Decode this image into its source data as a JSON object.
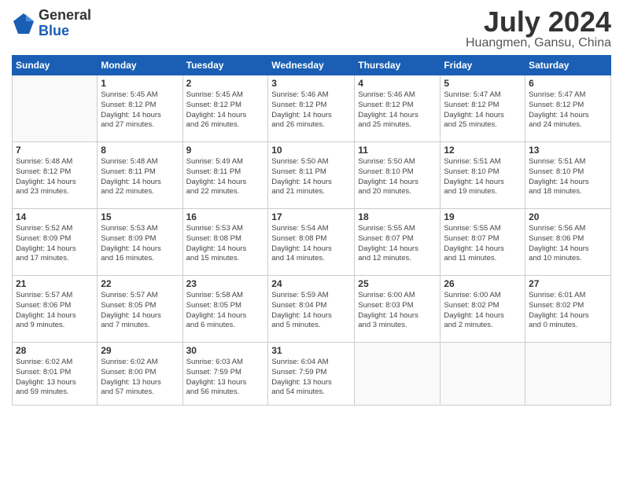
{
  "header": {
    "logo_general": "General",
    "logo_blue": "Blue",
    "title": "July 2024",
    "location": "Huangmen, Gansu, China"
  },
  "weekdays": [
    "Sunday",
    "Monday",
    "Tuesday",
    "Wednesday",
    "Thursday",
    "Friday",
    "Saturday"
  ],
  "weeks": [
    [
      {
        "day": "",
        "info": ""
      },
      {
        "day": "1",
        "info": "Sunrise: 5:45 AM\nSunset: 8:12 PM\nDaylight: 14 hours\nand 27 minutes."
      },
      {
        "day": "2",
        "info": "Sunrise: 5:45 AM\nSunset: 8:12 PM\nDaylight: 14 hours\nand 26 minutes."
      },
      {
        "day": "3",
        "info": "Sunrise: 5:46 AM\nSunset: 8:12 PM\nDaylight: 14 hours\nand 26 minutes."
      },
      {
        "day": "4",
        "info": "Sunrise: 5:46 AM\nSunset: 8:12 PM\nDaylight: 14 hours\nand 25 minutes."
      },
      {
        "day": "5",
        "info": "Sunrise: 5:47 AM\nSunset: 8:12 PM\nDaylight: 14 hours\nand 25 minutes."
      },
      {
        "day": "6",
        "info": "Sunrise: 5:47 AM\nSunset: 8:12 PM\nDaylight: 14 hours\nand 24 minutes."
      }
    ],
    [
      {
        "day": "7",
        "info": "Sunrise: 5:48 AM\nSunset: 8:12 PM\nDaylight: 14 hours\nand 23 minutes."
      },
      {
        "day": "8",
        "info": "Sunrise: 5:48 AM\nSunset: 8:11 PM\nDaylight: 14 hours\nand 22 minutes."
      },
      {
        "day": "9",
        "info": "Sunrise: 5:49 AM\nSunset: 8:11 PM\nDaylight: 14 hours\nand 22 minutes."
      },
      {
        "day": "10",
        "info": "Sunrise: 5:50 AM\nSunset: 8:11 PM\nDaylight: 14 hours\nand 21 minutes."
      },
      {
        "day": "11",
        "info": "Sunrise: 5:50 AM\nSunset: 8:10 PM\nDaylight: 14 hours\nand 20 minutes."
      },
      {
        "day": "12",
        "info": "Sunrise: 5:51 AM\nSunset: 8:10 PM\nDaylight: 14 hours\nand 19 minutes."
      },
      {
        "day": "13",
        "info": "Sunrise: 5:51 AM\nSunset: 8:10 PM\nDaylight: 14 hours\nand 18 minutes."
      }
    ],
    [
      {
        "day": "14",
        "info": "Sunrise: 5:52 AM\nSunset: 8:09 PM\nDaylight: 14 hours\nand 17 minutes."
      },
      {
        "day": "15",
        "info": "Sunrise: 5:53 AM\nSunset: 8:09 PM\nDaylight: 14 hours\nand 16 minutes."
      },
      {
        "day": "16",
        "info": "Sunrise: 5:53 AM\nSunset: 8:08 PM\nDaylight: 14 hours\nand 15 minutes."
      },
      {
        "day": "17",
        "info": "Sunrise: 5:54 AM\nSunset: 8:08 PM\nDaylight: 14 hours\nand 14 minutes."
      },
      {
        "day": "18",
        "info": "Sunrise: 5:55 AM\nSunset: 8:07 PM\nDaylight: 14 hours\nand 12 minutes."
      },
      {
        "day": "19",
        "info": "Sunrise: 5:55 AM\nSunset: 8:07 PM\nDaylight: 14 hours\nand 11 minutes."
      },
      {
        "day": "20",
        "info": "Sunrise: 5:56 AM\nSunset: 8:06 PM\nDaylight: 14 hours\nand 10 minutes."
      }
    ],
    [
      {
        "day": "21",
        "info": "Sunrise: 5:57 AM\nSunset: 8:06 PM\nDaylight: 14 hours\nand 9 minutes."
      },
      {
        "day": "22",
        "info": "Sunrise: 5:57 AM\nSunset: 8:05 PM\nDaylight: 14 hours\nand 7 minutes."
      },
      {
        "day": "23",
        "info": "Sunrise: 5:58 AM\nSunset: 8:05 PM\nDaylight: 14 hours\nand 6 minutes."
      },
      {
        "day": "24",
        "info": "Sunrise: 5:59 AM\nSunset: 8:04 PM\nDaylight: 14 hours\nand 5 minutes."
      },
      {
        "day": "25",
        "info": "Sunrise: 6:00 AM\nSunset: 8:03 PM\nDaylight: 14 hours\nand 3 minutes."
      },
      {
        "day": "26",
        "info": "Sunrise: 6:00 AM\nSunset: 8:02 PM\nDaylight: 14 hours\nand 2 minutes."
      },
      {
        "day": "27",
        "info": "Sunrise: 6:01 AM\nSunset: 8:02 PM\nDaylight: 14 hours\nand 0 minutes."
      }
    ],
    [
      {
        "day": "28",
        "info": "Sunrise: 6:02 AM\nSunset: 8:01 PM\nDaylight: 13 hours\nand 59 minutes."
      },
      {
        "day": "29",
        "info": "Sunrise: 6:02 AM\nSunset: 8:00 PM\nDaylight: 13 hours\nand 57 minutes."
      },
      {
        "day": "30",
        "info": "Sunrise: 6:03 AM\nSunset: 7:59 PM\nDaylight: 13 hours\nand 56 minutes."
      },
      {
        "day": "31",
        "info": "Sunrise: 6:04 AM\nSunset: 7:59 PM\nDaylight: 13 hours\nand 54 minutes."
      },
      {
        "day": "",
        "info": ""
      },
      {
        "day": "",
        "info": ""
      },
      {
        "day": "",
        "info": ""
      }
    ]
  ]
}
